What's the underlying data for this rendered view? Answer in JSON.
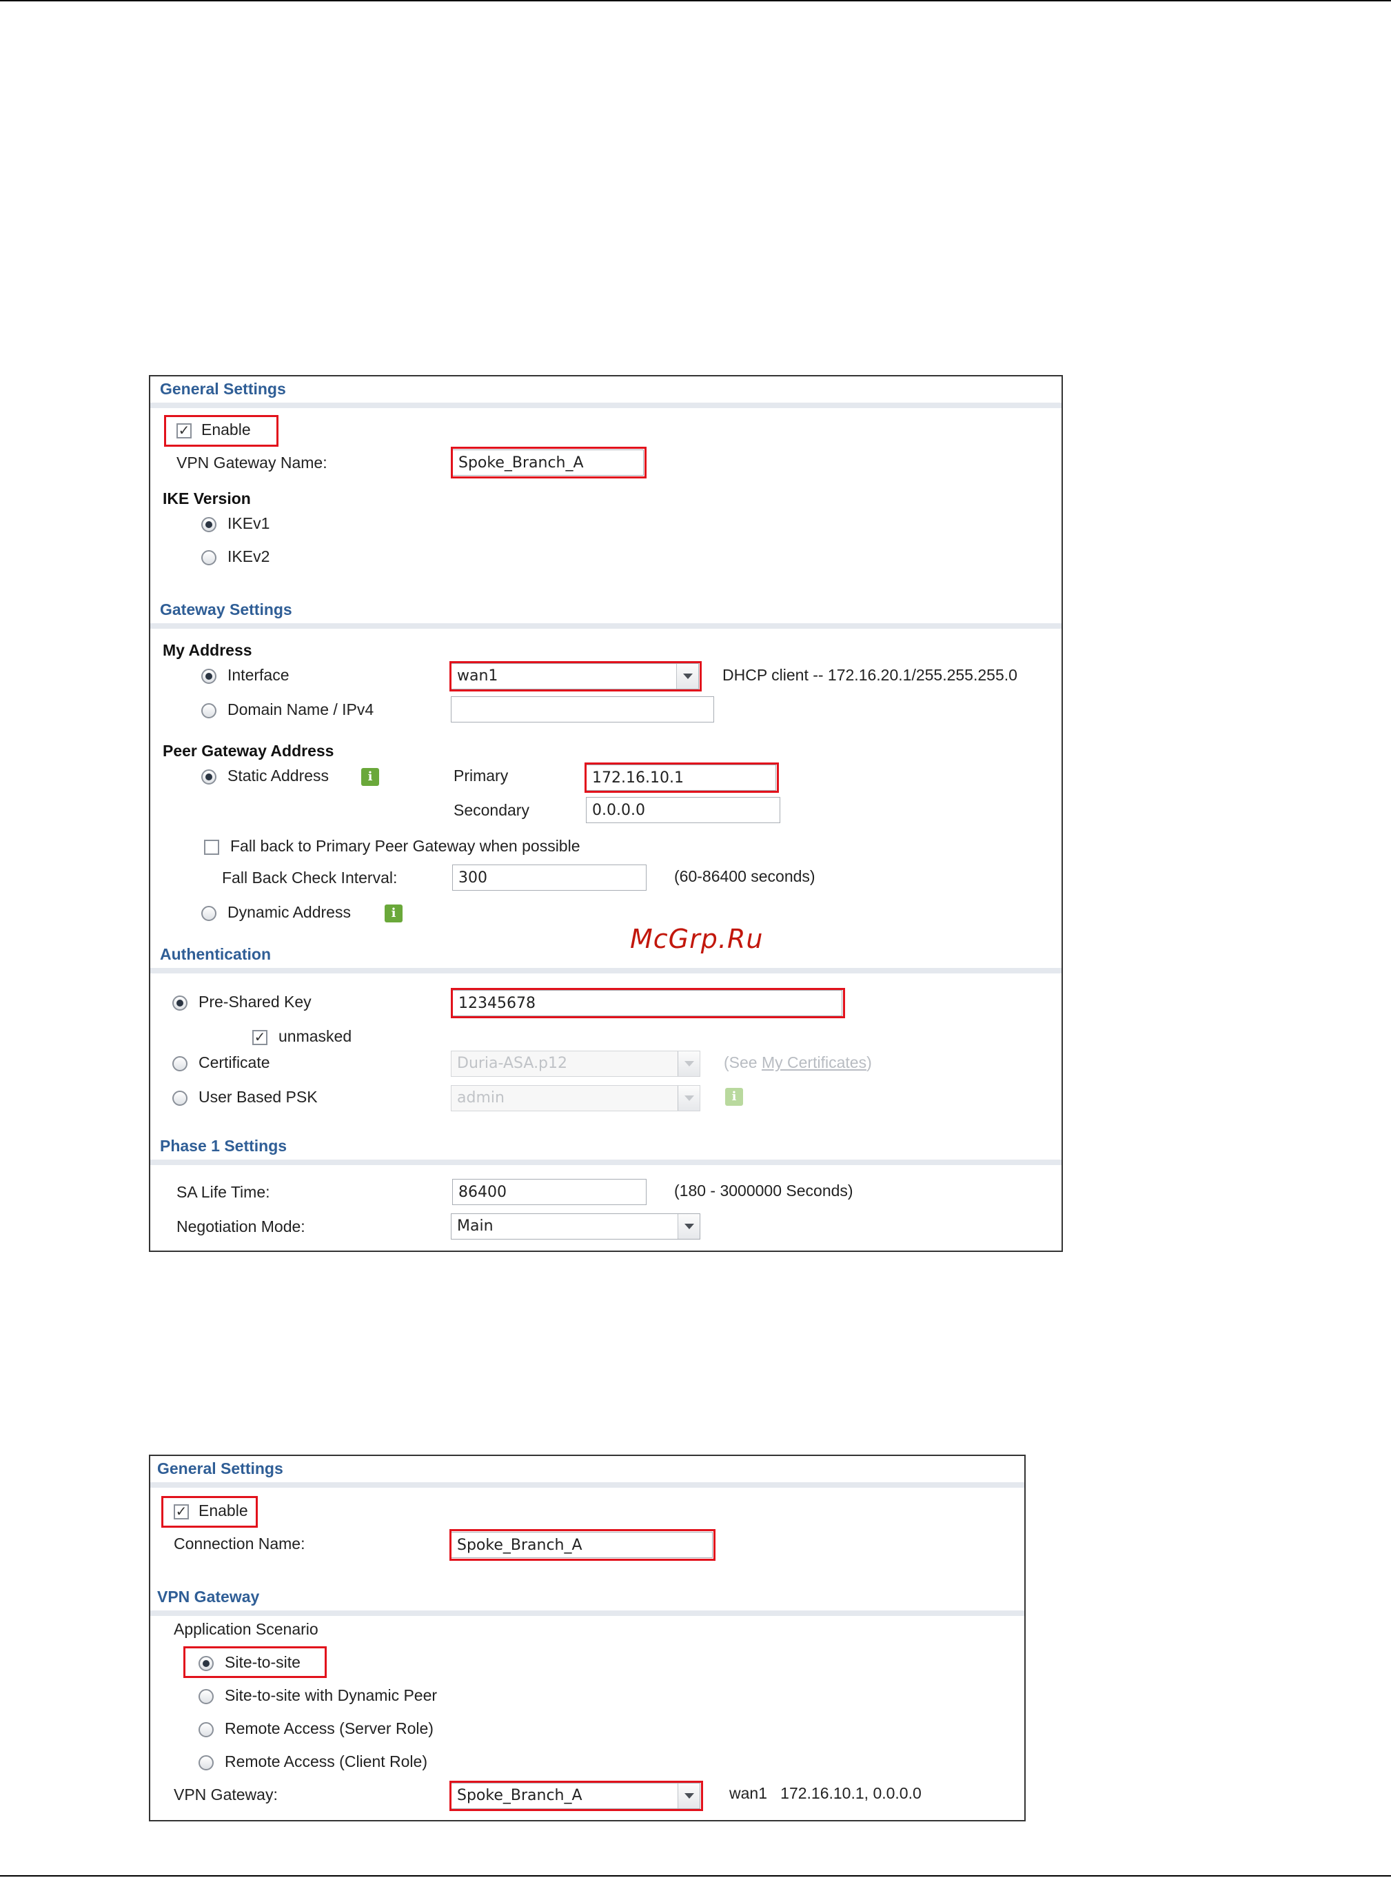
{
  "panel1": {
    "general_settings": {
      "title": "General Settings",
      "enable_label": "Enable",
      "enable_checked": true,
      "gateway_name_label": "VPN Gateway Name:",
      "gateway_name_value": "Spoke_Branch_A",
      "ike_version_label": "IKE Version",
      "ikev1_label": "IKEv1",
      "ikev2_label": "IKEv2",
      "ike_selected": "IKEv1"
    },
    "gateway_settings": {
      "title": "Gateway Settings",
      "my_address_label": "My Address",
      "interface_label": "Interface",
      "interface_value": "wan1",
      "interface_info": "DHCP client -- 172.16.20.1/255.255.255.0",
      "domain_label": "Domain Name / IPv4",
      "domain_value": "",
      "peer_label": "Peer Gateway Address",
      "static_label": "Static Address",
      "primary_label": "Primary",
      "primary_value": "172.16.10.1",
      "secondary_label": "Secondary",
      "secondary_value": "0.0.0.0",
      "fallback_label": "Fall back to Primary Peer Gateway when possible",
      "fallback_interval_label": "Fall Back Check Interval:",
      "fallback_interval_value": "300",
      "fallback_range": "(60-86400 seconds)",
      "dynamic_label": "Dynamic Address"
    },
    "authentication": {
      "title": "Authentication",
      "psk_label": "Pre-Shared Key",
      "psk_value": "12345678",
      "unmasked_label": "unmasked",
      "certificate_label": "Certificate",
      "certificate_value": "Duria-ASA.p12",
      "see_prefix": "(See ",
      "see_link": "My Certificates",
      "see_suffix": ")",
      "user_psk_label": "User Based PSK",
      "user_psk_value": "admin"
    },
    "phase1": {
      "title": "Phase 1 Settings",
      "sa_life_label": "SA Life Time:",
      "sa_life_value": "86400",
      "sa_life_range": "(180 - 3000000 Seconds)",
      "negotiation_label": "Negotiation Mode:",
      "negotiation_value": "Main"
    }
  },
  "watermark": "McGrp.Ru",
  "panel2": {
    "general_settings": {
      "title": "General Settings",
      "enable_label": "Enable",
      "connection_name_label": "Connection Name:",
      "connection_name_value": "Spoke_Branch_A"
    },
    "vpn_gateway": {
      "title": "VPN Gateway",
      "scenario_label": "Application Scenario",
      "scenarios": [
        "Site-to-site",
        "Site-to-site with Dynamic Peer",
        "Remote Access (Server Role)",
        "Remote Access (Client Role)"
      ],
      "selected_scenario": "Site-to-site",
      "gateway_label": "VPN Gateway:",
      "gateway_value": "Spoke_Branch_A",
      "gateway_info": "wan1   172.16.10.1, 0.0.0.0"
    }
  },
  "colors": {
    "section_title": "#2f5e96",
    "highlight": "#e2121c",
    "info_icon": "#6aa83a"
  }
}
